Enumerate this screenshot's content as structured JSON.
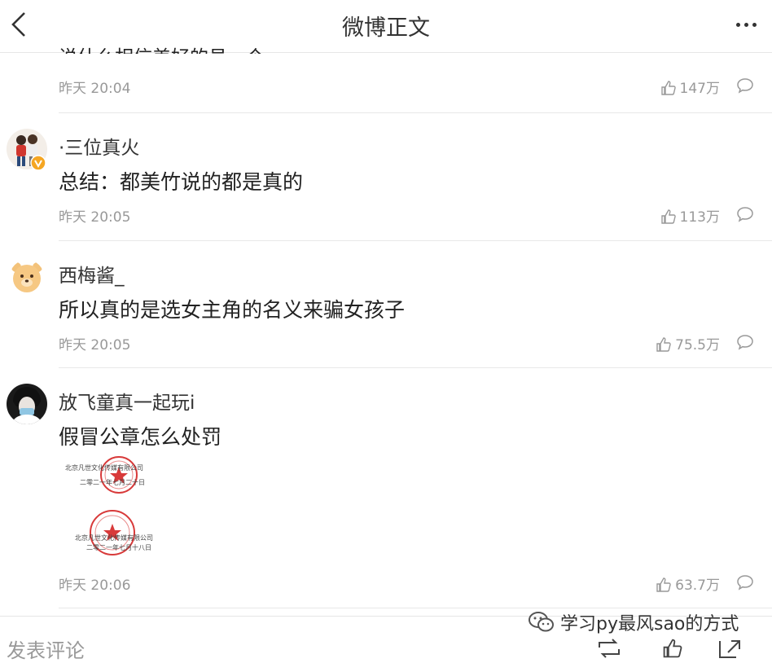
{
  "header": {
    "title": "微博正文"
  },
  "partial_comment": {
    "text_fragment": "说什么相信美好的员一个",
    "time": "昨天 20:04",
    "likes": "147万"
  },
  "comments": [
    {
      "user": "·三位真火",
      "verified": true,
      "text": "总结：都美竹说的都是真的",
      "time": "昨天 20:05",
      "likes": "113万"
    },
    {
      "user": "西梅酱_",
      "verified": false,
      "text": "所以真的是选女主角的名义来骗女孩子",
      "time": "昨天 20:05",
      "likes": "75.5万"
    },
    {
      "user": "放飞童真一起玩i",
      "verified": false,
      "text": "假冒公章怎么处罚",
      "time": "昨天 20:06",
      "likes": "63.7万",
      "image": {
        "seal_top_line1": "北京凡世文化传媒有限公司",
        "seal_top_line2": "二零二一年七月二十日",
        "seal_bottom_line1": "北京凡世文化传媒有限公司",
        "seal_bottom_line2": "二零二一年七月十八日"
      }
    }
  ],
  "footer": {
    "post_comment": "发表评论"
  },
  "watermark": {
    "text": "学习py最风sao的方式"
  },
  "colors": {
    "accent_verified": "#f5a623",
    "seal_red": "#d83a3a",
    "meta_gray": "#999999"
  }
}
